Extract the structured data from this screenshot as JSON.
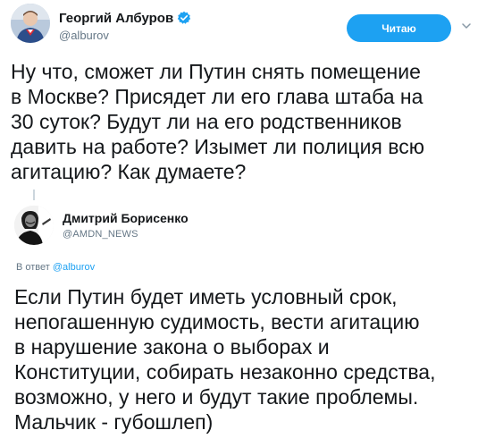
{
  "tweet1": {
    "author_name": "Георгий Албуров",
    "author_handle": "@alburov",
    "verified_icon": "verified-badge-icon",
    "follow_label": "Читаю",
    "text": "Ну что, сможет ли Путин снять помещение\nв Москве? Присядет ли его глава штаба на\n30 суток? Будут ли на его родственников\nдавить на работе? Изымет ли полиция всю\nагитацию? Как думаете?"
  },
  "tweet2": {
    "author_name": "Дмитрий Борисенко",
    "author_handle": "@AMDN_NEWS",
    "reply_prefix": "В ответ",
    "reply_to": "@alburov",
    "text": "Если Путин будет иметь условный срок,\nнепогашенную судимость, вести агитацию\nв нарушение закона о выборах и\nКонституции, собирать незаконно средства,\nвозможно, у него и будут такие проблемы.\nМальчик - губошлеп)"
  },
  "colors": {
    "accent": "#1da1f2",
    "muted": "#657786",
    "text": "#14171a",
    "thread_line": "#ccd6dd"
  }
}
